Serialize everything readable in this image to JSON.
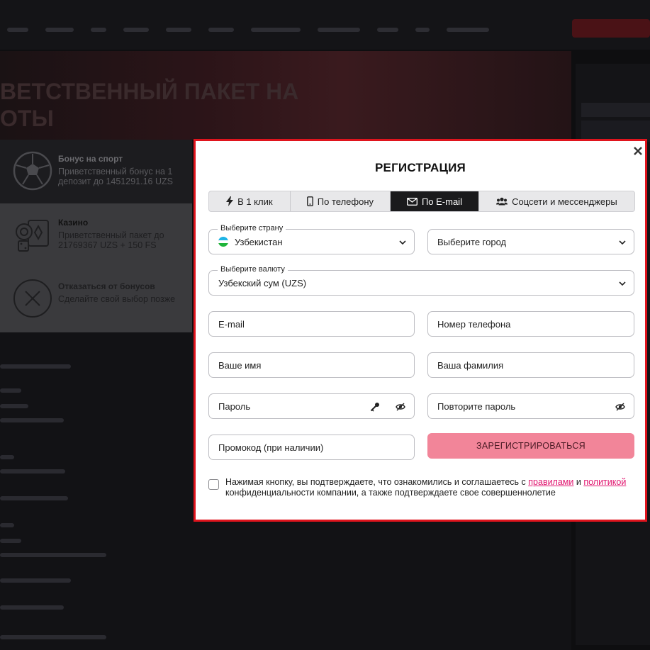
{
  "bonus_panel": {
    "items": [
      {
        "title": "Бонус на спорт",
        "desc": "Приветственный бонус на 1 депозит до 1451291.16 UZS"
      },
      {
        "title": "Казино",
        "desc": "Приветственный пакет до 21769367 UZS + 150 FS"
      },
      {
        "title": "Отказаться от бонусов",
        "desc": "Сделайте свой выбор позже"
      }
    ]
  },
  "banner": {
    "title_line1": "ВЕТСТВЕННЫЙ ПАКЕТ НА",
    "title_line2": "ОТЫ"
  },
  "modal": {
    "title": "РЕГИСТРАЦИЯ",
    "tabs": [
      {
        "label": "В 1 клик",
        "icon": "lightning-icon"
      },
      {
        "label": "По телефону",
        "icon": "phone-icon"
      },
      {
        "label": "По E-mail",
        "icon": "envelope-icon",
        "active": true
      },
      {
        "label": "Соцсети и мессенджеры",
        "icon": "users-icon"
      }
    ],
    "country": {
      "label": "Выберите страну",
      "value": "Узбекистан"
    },
    "city": {
      "placeholder": "Выберите город"
    },
    "currency": {
      "label": "Выберите валюту",
      "value": "Узбекский сум (UZS)"
    },
    "email": {
      "placeholder": "E-mail"
    },
    "phone": {
      "placeholder": "Номер телефона"
    },
    "first_name": {
      "placeholder": "Ваше имя"
    },
    "last_name": {
      "placeholder": "Ваша фамилия"
    },
    "password": {
      "placeholder": "Пароль"
    },
    "password_repeat": {
      "placeholder": "Повторите пароль"
    },
    "promo": {
      "placeholder": "Промокод (при наличии)"
    },
    "register_label": "ЗАРЕГИСТРИРОВАТЬСЯ",
    "agreement": {
      "text1": "Нажимая кнопку, вы подтверждаете, что ознакомились и соглашаетесь с ",
      "link1": "правилами",
      "text2": " и ",
      "link2": "политикой",
      "text3": " конфиденциальности компании, а также подтверждаете свое совершеннолетие"
    }
  },
  "colors": {
    "modal_border": "#e0141d",
    "register_button": "#f28599",
    "link": "#e0146e",
    "active_tab": "#1a1a1c"
  }
}
